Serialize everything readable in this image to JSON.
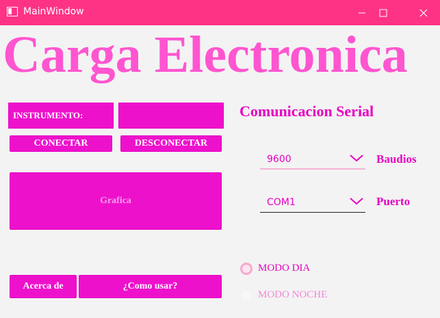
{
  "window": {
    "title": "MainWindow",
    "icon": "app-window-icon",
    "controls": [
      "minimize-icon",
      "maximize-icon",
      "close-icon"
    ]
  },
  "header": {
    "title": "Carga Electronica"
  },
  "instrument": {
    "label": "INSTRUMENTO:",
    "value": ""
  },
  "buttons": {
    "connect": "CONECTAR",
    "disconnect": "DESCONECTAR",
    "graph": "Grafica",
    "about": "Acerca de",
    "how_to": "¿Como usar?"
  },
  "serial": {
    "title": "Comunicacion Serial",
    "baud_value": "9600",
    "baud_label": "Baudios",
    "port_value": "COM1",
    "port_label": "Puerto"
  },
  "modes": {
    "day": "MODO DIA",
    "night": "MODO NOCHE",
    "selected": "day"
  },
  "colors": {
    "titlebar": "#ff3385",
    "accent": "#ee11cc",
    "title_text": "#ff55d0",
    "background": "#f3f3f3"
  }
}
